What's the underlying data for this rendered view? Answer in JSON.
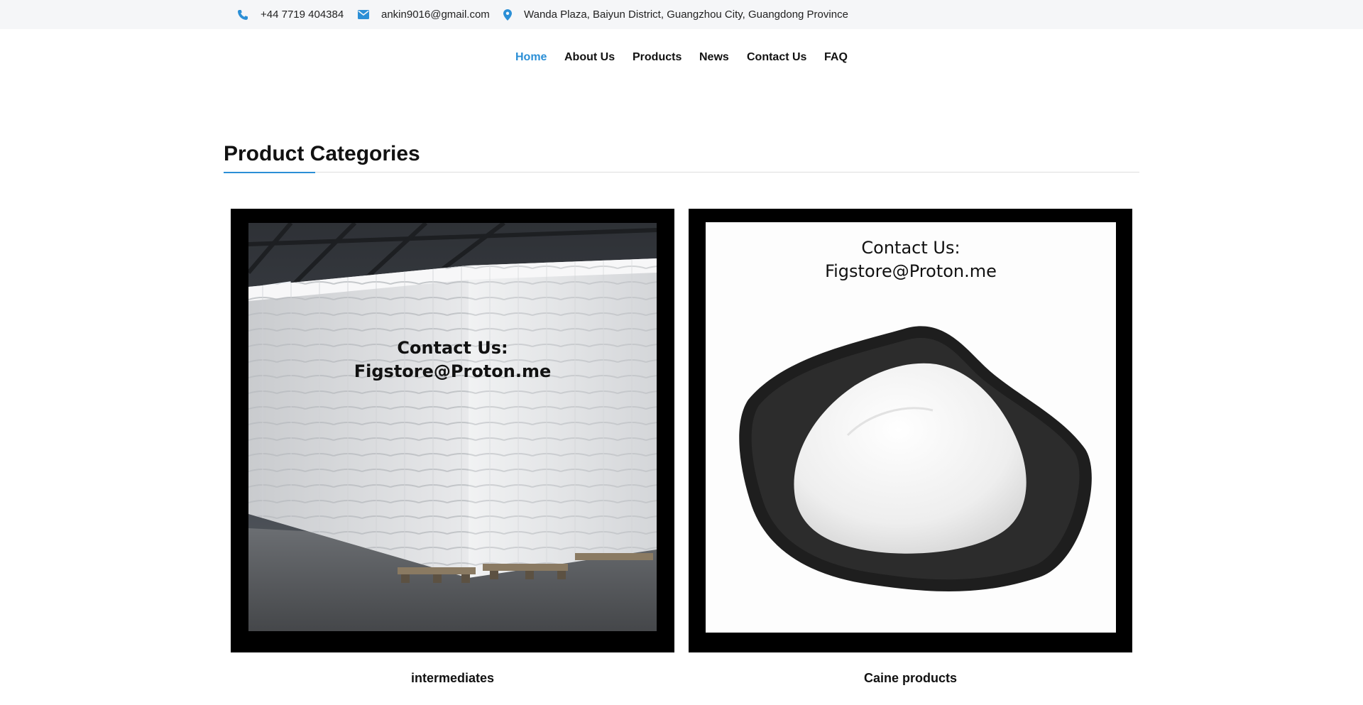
{
  "topbar": {
    "phone": "+44 7719 404384",
    "email": "ankin9016@gmail.com",
    "address": "Wanda Plaza, Baiyun District, Guangzhou City, Guangdong Province",
    "icon_color": "#2b8fd6"
  },
  "nav": {
    "items": [
      {
        "label": "Home",
        "active": true
      },
      {
        "label": "About Us"
      },
      {
        "label": "Products"
      },
      {
        "label": "News"
      },
      {
        "label": "Contact Us"
      },
      {
        "label": "FAQ"
      }
    ],
    "active_color": "#2b8fd6"
  },
  "section": {
    "title": "Product Categories"
  },
  "categories": [
    {
      "label": "intermediates",
      "image_icon": "warehouse-sacks-photo",
      "overlay_line1": "Contact Us:",
      "overlay_line2": "Figstore@Proton.me"
    },
    {
      "label": "Caine products",
      "image_icon": "white-powder-dish-photo",
      "overlay_line1": "Contact Us:",
      "overlay_line2": "Figstore@Proton.me"
    }
  ]
}
